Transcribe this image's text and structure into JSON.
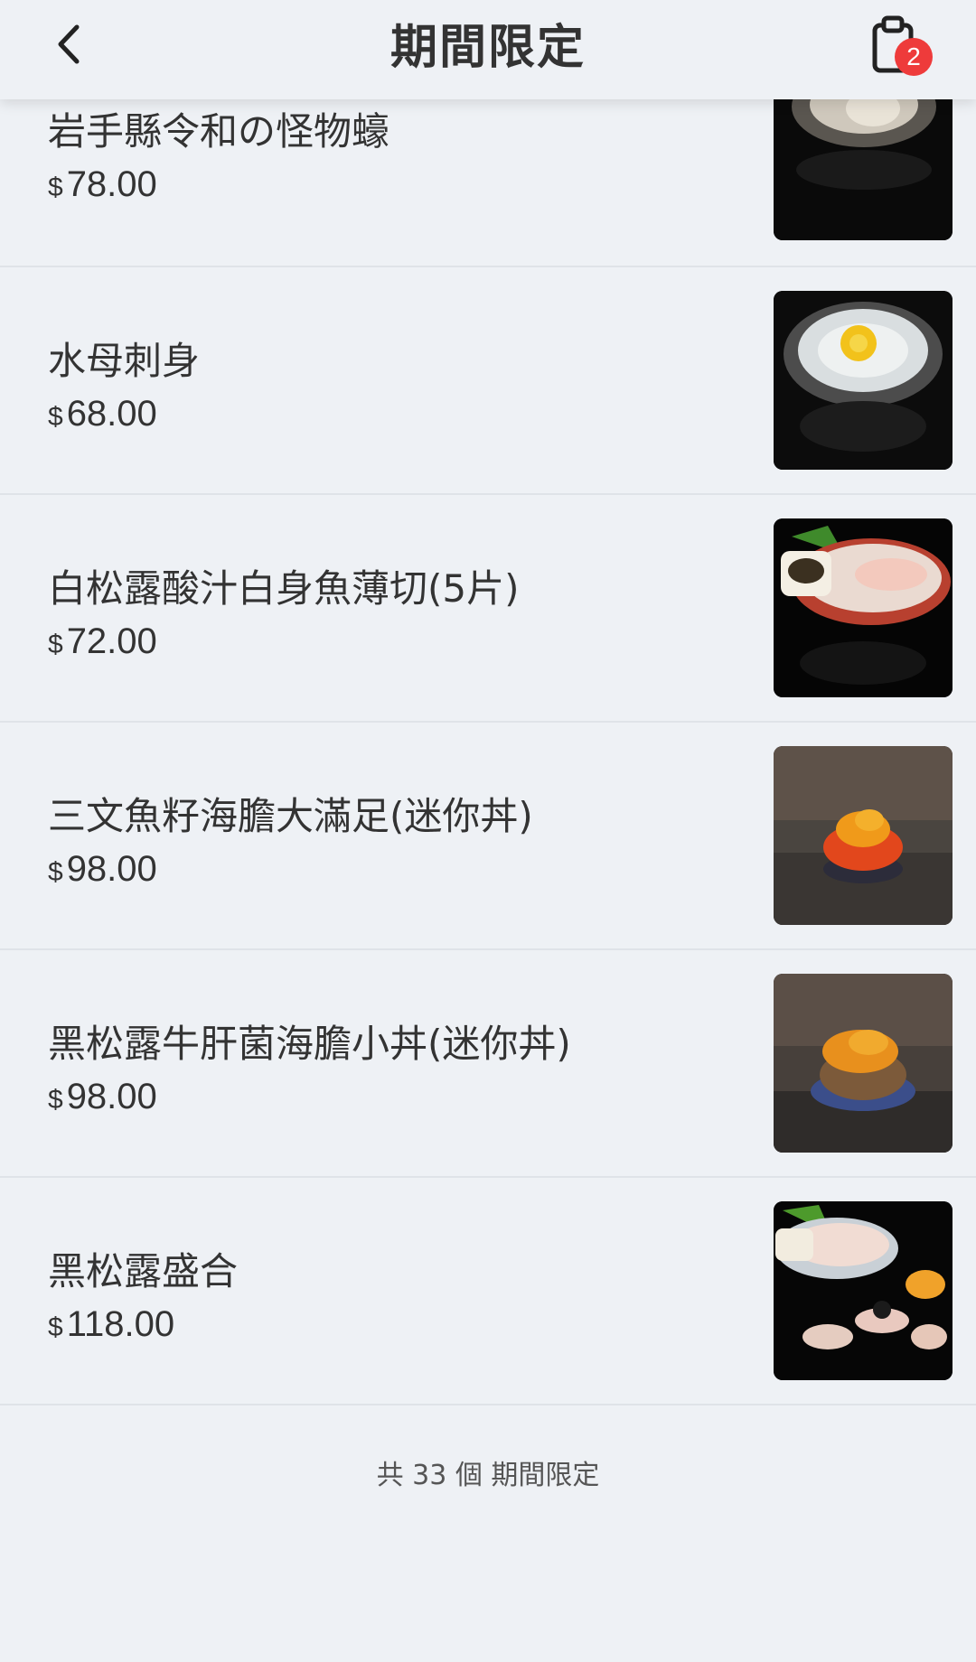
{
  "header": {
    "title": "期間限定",
    "cart_count": "2"
  },
  "items": [
    {
      "name": "岩手縣令和の怪物蠔",
      "currency": "$",
      "price": "78.00",
      "image": "oyster-photo"
    },
    {
      "name": "水母刺身",
      "currency": "$",
      "price": "68.00",
      "image": "jellyfish-sashimi-photo"
    },
    {
      "name": "白松露酸汁白身魚薄切(5片)",
      "currency": "$",
      "price": "72.00",
      "image": "white-fish-carpaccio-photo"
    },
    {
      "name": "三文魚籽海膽大滿足(迷你丼)",
      "currency": "$",
      "price": "98.00",
      "image": "salmon-roe-uni-don-photo"
    },
    {
      "name": "黑松露牛肝菌海膽小丼(迷你丼)",
      "currency": "$",
      "price": "98.00",
      "image": "truffle-uni-don-photo"
    },
    {
      "name": "黑松露盛合",
      "currency": "$",
      "price": "118.00",
      "image": "truffle-platter-photo"
    }
  ],
  "footer": {
    "count_text": "共 33 個 期間限定"
  },
  "colors": {
    "background": "#eef1f5",
    "badge": "#ee3b3b",
    "divider": "#dfe3e8"
  }
}
